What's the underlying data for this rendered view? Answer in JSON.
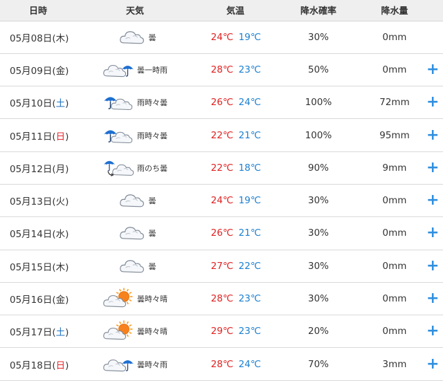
{
  "headers": {
    "date": "日時",
    "weather": "天気",
    "temp": "気温",
    "prob": "降水確率",
    "amount": "降水量"
  },
  "colors": {
    "max_temp": "#e02020",
    "min_temp": "#1a7fd0",
    "saturday": "#1a6fc0",
    "sunday": "#e0282e",
    "accent_plus": "#2f8fdf"
  },
  "rows": [
    {
      "pre": "05月08日(",
      "dow": "木",
      "post": ")",
      "dow_type": "weekday",
      "icon": "cloud-icon",
      "weather": "曇",
      "max": "24℃",
      "min": "19℃",
      "prob": "30%",
      "amount": "0mm",
      "plus": ""
    },
    {
      "pre": "05月09日(",
      "dow": "金",
      "post": ")",
      "dow_type": "weekday",
      "icon": "cloud-umbrella-icon",
      "weather": "曇一時雨",
      "max": "28℃",
      "min": "23℃",
      "prob": "50%",
      "amount": "0mm",
      "plus": "+"
    },
    {
      "pre": "05月10日(",
      "dow": "土",
      "post": ")",
      "dow_type": "saturday",
      "icon": "umbrella-cloud-icon",
      "weather": "雨時々曇",
      "max": "26℃",
      "min": "24℃",
      "prob": "100%",
      "amount": "72mm",
      "plus": "+"
    },
    {
      "pre": "05月11日(",
      "dow": "日",
      "post": ")",
      "dow_type": "sunday",
      "icon": "umbrella-cloud-icon",
      "weather": "雨時々曇",
      "max": "22℃",
      "min": "21℃",
      "prob": "100%",
      "amount": "95mm",
      "plus": "+"
    },
    {
      "pre": "05月12日(",
      "dow": "月",
      "post": ")",
      "dow_type": "weekday",
      "icon": "umbrella-then-cloud-icon",
      "weather": "雨のち曇",
      "max": "22℃",
      "min": "18℃",
      "prob": "90%",
      "amount": "9mm",
      "plus": "+"
    },
    {
      "pre": "05月13日(",
      "dow": "火",
      "post": ")",
      "dow_type": "weekday",
      "icon": "cloud-icon",
      "weather": "曇",
      "max": "24℃",
      "min": "19℃",
      "prob": "30%",
      "amount": "0mm",
      "plus": "+"
    },
    {
      "pre": "05月14日(",
      "dow": "水",
      "post": ")",
      "dow_type": "weekday",
      "icon": "cloud-icon",
      "weather": "曇",
      "max": "26℃",
      "min": "21℃",
      "prob": "30%",
      "amount": "0mm",
      "plus": "+"
    },
    {
      "pre": "05月15日(",
      "dow": "木",
      "post": ")",
      "dow_type": "weekday",
      "icon": "cloud-icon",
      "weather": "曇",
      "max": "27℃",
      "min": "22℃",
      "prob": "30%",
      "amount": "0mm",
      "plus": "+"
    },
    {
      "pre": "05月16日(",
      "dow": "金",
      "post": ")",
      "dow_type": "weekday",
      "icon": "cloud-sun-icon",
      "weather": "曇時々晴",
      "max": "28℃",
      "min": "23℃",
      "prob": "30%",
      "amount": "0mm",
      "plus": "+"
    },
    {
      "pre": "05月17日(",
      "dow": "土",
      "post": ")",
      "dow_type": "saturday",
      "icon": "cloud-sun-icon",
      "weather": "曇時々晴",
      "max": "29℃",
      "min": "23℃",
      "prob": "20%",
      "amount": "0mm",
      "plus": "+"
    },
    {
      "pre": "05月18日(",
      "dow": "日",
      "post": ")",
      "dow_type": "sunday",
      "icon": "cloud-umbrella-icon",
      "weather": "曇時々雨",
      "max": "28℃",
      "min": "24℃",
      "prob": "70%",
      "amount": "3mm",
      "plus": "+"
    }
  ]
}
